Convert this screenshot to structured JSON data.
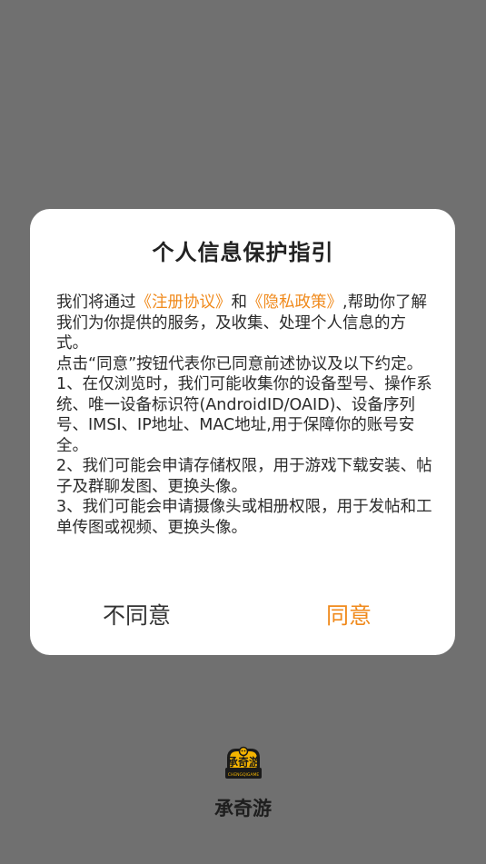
{
  "dialog": {
    "title": "个人信息保护指引",
    "intro_prefix": "我们将通过",
    "agreement_link": "《注册协议》",
    "and": "和",
    "privacy_link": "《隐私政策》",
    "intro_suffix": ",帮助你了解我们为你提供的服务，及收集、处理个人信息的方式。",
    "consent_note": "点击“同意”按钮代表你已同意前述协议及以下约定。",
    "items": [
      "1、在仅浏览时，我们可能收集你的设备型号、操作系统、唯一设备标识符(AndroidID/OAID)、设备序列号、IMSI、IP地址、MAC地址,用于保障你的账号安全。",
      "2、我们可能会申请存储权限，用于游戏下载安装、帖子及群聊发图、更换头像。",
      "3、我们可能会申请摄像头或相册权限，用于发帖和工单传图或视频、更换头像。"
    ],
    "disagree_label": "不同意",
    "agree_label": "同意"
  },
  "app": {
    "logo_text": "承奇游",
    "logo_subtext": "CHENGQIGAME",
    "name": "承奇游"
  },
  "colors": {
    "accent": "#f08a1c",
    "overlay": "#707070",
    "dialog_bg": "#ffffff",
    "logo_yellow": "#f4b400",
    "logo_dark": "#1a1a1a"
  }
}
